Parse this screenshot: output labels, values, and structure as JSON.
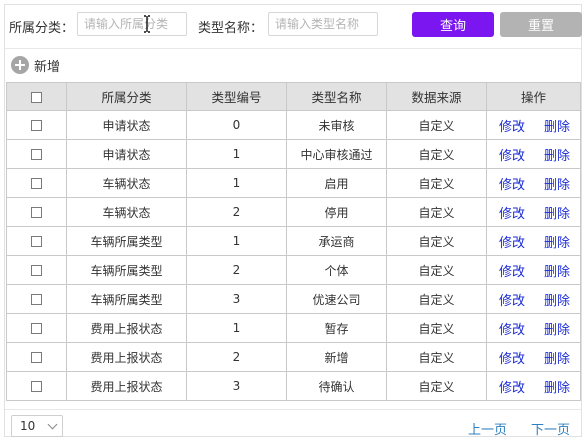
{
  "filter": {
    "category_label": "所属分类：",
    "category_placeholder": "请输入所属分类",
    "type_name_label": "类型名称：",
    "type_name_placeholder": "请输入类型名称",
    "query_button": "查询",
    "reset_button": "重置"
  },
  "toolbar": {
    "add_label": "新增"
  },
  "table": {
    "headers": [
      "所属分类",
      "类型编号",
      "类型名称",
      "数据来源",
      "操作"
    ],
    "rows": [
      {
        "category": "申请状态",
        "code": "0",
        "name": "未审核",
        "source": "自定义",
        "edit": "修改",
        "delete": "删除"
      },
      {
        "category": "申请状态",
        "code": "1",
        "name": "中心审核通过",
        "source": "自定义",
        "edit": "修改",
        "delete": "删除"
      },
      {
        "category": "车辆状态",
        "code": "1",
        "name": "启用",
        "source": "自定义",
        "edit": "修改",
        "delete": "删除"
      },
      {
        "category": "车辆状态",
        "code": "2",
        "name": "停用",
        "source": "自定义",
        "edit": "修改",
        "delete": "删除"
      },
      {
        "category": "车辆所属类型",
        "code": "1",
        "name": "承运商",
        "source": "自定义",
        "edit": "修改",
        "delete": "删除"
      },
      {
        "category": "车辆所属类型",
        "code": "2",
        "name": "个体",
        "source": "自定义",
        "edit": "修改",
        "delete": "删除"
      },
      {
        "category": "车辆所属类型",
        "code": "3",
        "name": "优速公司",
        "source": "自定义",
        "edit": "修改",
        "delete": "删除"
      },
      {
        "category": "费用上报状态",
        "code": "1",
        "name": "暂存",
        "source": "自定义",
        "edit": "修改",
        "delete": "删除"
      },
      {
        "category": "费用上报状态",
        "code": "2",
        "name": "新增",
        "source": "自定义",
        "edit": "修改",
        "delete": "删除"
      },
      {
        "category": "费用上报状态",
        "code": "3",
        "name": "待确认",
        "source": "自定义",
        "edit": "修改",
        "delete": "删除"
      }
    ]
  },
  "pager": {
    "page_size": "10",
    "prev": "上一页",
    "next": "下一页"
  }
}
